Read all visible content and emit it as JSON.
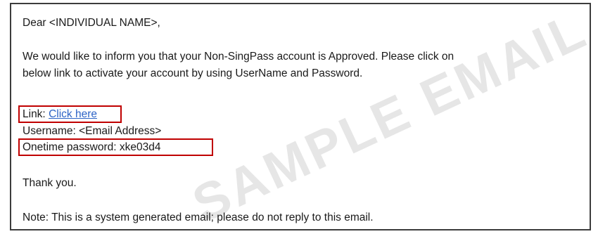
{
  "email": {
    "greeting": "Dear <INDIVIDUAL NAME>,",
    "body_line_1": "We would like to inform you that your Non-SingPass account is Approved. Please click on",
    "body_line_2": "below link to activate your account by using UserName and Password.",
    "link_label": "Link: ",
    "link_text": "Click here",
    "username_line": "Username: <Email Address>",
    "otp_line": "Onetime password: xke03d4",
    "closing": "Thank you.",
    "note": "Note: This is a system generated email; please do not reply to this email."
  },
  "watermark": {
    "text": "SAMPLE EMAIL"
  },
  "colors": {
    "link": "#2e64c6",
    "highlight_border": "#c00000",
    "frame_border": "#3c3c3c",
    "watermark": "#cdcdcd"
  }
}
